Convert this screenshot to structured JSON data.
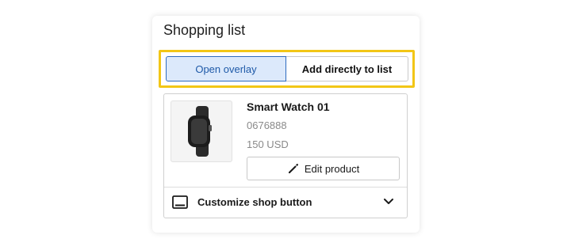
{
  "panel": {
    "title": "Shopping list"
  },
  "toggle": {
    "options": [
      {
        "label": "Open overlay",
        "active": true
      },
      {
        "label": "Add directly to list",
        "active": false
      }
    ],
    "highlight_color": "#f2c616",
    "active_color": "#2f6bbf"
  },
  "product": {
    "name": "Smart Watch 01",
    "id": "0676888",
    "price": "150 USD",
    "image_icon": "smartwatch-icon"
  },
  "actions": {
    "edit_label": "Edit product",
    "edit_icon": "pencil-icon"
  },
  "customize": {
    "label": "Customize shop button",
    "icon": "monitor-icon",
    "expand_icon": "chevron-down-icon"
  }
}
